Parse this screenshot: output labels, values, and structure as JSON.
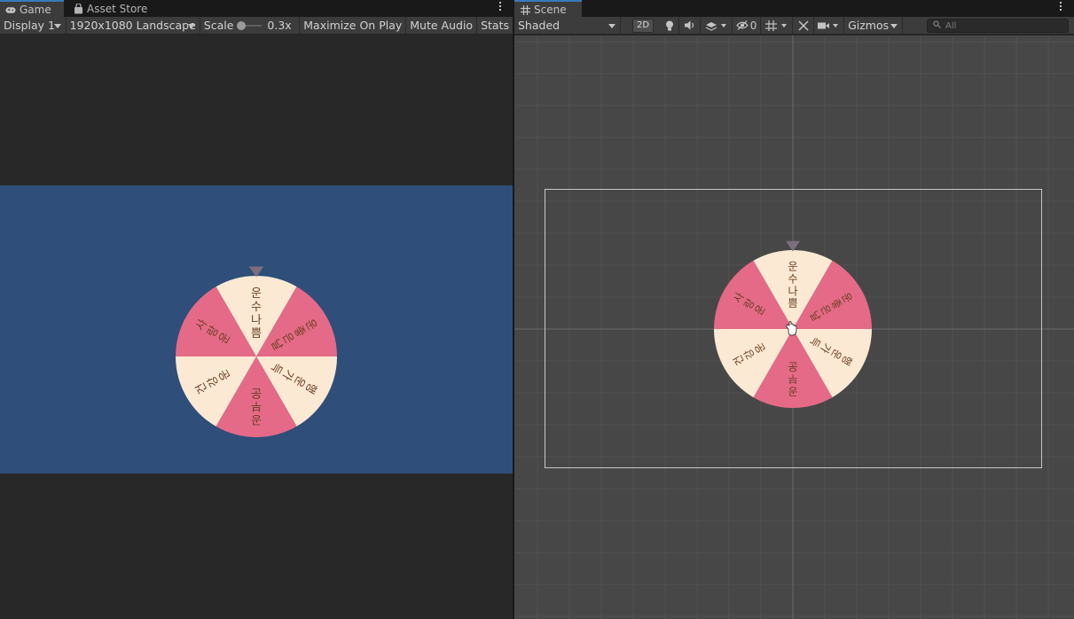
{
  "tabs": {
    "game_label": "Game",
    "asset_store_label": "Asset Store",
    "scene_label": "Scene"
  },
  "game_toolbar": {
    "display": "Display 1",
    "resolution": "1920x1080 Landscape",
    "scale_label": "Scale",
    "scale_value": "0.3x",
    "maximize": "Maximize On Play",
    "mute": "Mute Audio",
    "stats": "Stats"
  },
  "scene_toolbar": {
    "draw_mode": "Shaded",
    "mode_2d": "2D",
    "hidden_count": "0",
    "gizmos": "Gizmos",
    "search_placeholder": "All",
    "icons": [
      "light-icon",
      "audio-icon",
      "effects-icon",
      "visibility-icon",
      "grid-icon",
      "tools-icon",
      "camera-icon"
    ]
  },
  "wheel": {
    "segments": [
      {
        "label": "운수나쁨",
        "color": "#fbe9d3"
      },
      {
        "label": "운좋은날",
        "color": "#e56a87"
      },
      {
        "label": "행운가득",
        "color": "#fbe9d3"
      },
      {
        "label": "공부운",
        "color": "#e56a87"
      },
      {
        "label": "건강운",
        "color": "#fbe9d3"
      },
      {
        "label": "사랑운",
        "color": "#e56a87"
      }
    ],
    "pointer_color": "#7c6d7f",
    "text_color": "#6b3f23"
  },
  "colors": {
    "game_background": "#2f4e79",
    "scene_background": "#474747",
    "tab_accent": "#3a79bb"
  }
}
